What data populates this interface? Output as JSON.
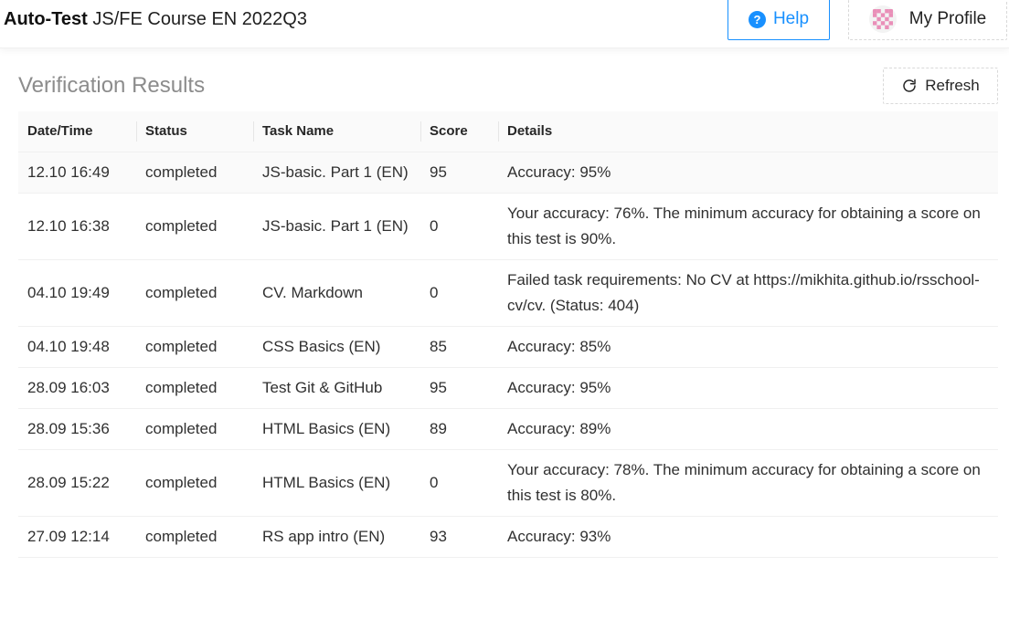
{
  "header": {
    "app_name": "Auto-Test",
    "course": "JS/FE Course EN 2022Q3",
    "help_label": "Help",
    "profile_label": "My Profile"
  },
  "page": {
    "title": "Verification Results",
    "refresh_label": "Refresh"
  },
  "table": {
    "columns": [
      "Date/Time",
      "Status",
      "Task Name",
      "Score",
      "Details"
    ],
    "rows": [
      {
        "datetime": "12.10 16:49",
        "status": "completed",
        "task": "JS-basic. Part 1 (EN)",
        "score": "95",
        "details": "Accuracy: 95%"
      },
      {
        "datetime": "12.10 16:38",
        "status": "completed",
        "task": "JS-basic. Part 1 (EN)",
        "score": "0",
        "details": "Your accuracy: 76%. The minimum accuracy for obtaining a score on this test is 90%."
      },
      {
        "datetime": "04.10 19:49",
        "status": "completed",
        "task": "CV. Markdown",
        "score": "0",
        "details": "Failed task requirements: No CV at https://mikhita.github.io/rsschool-cv/cv. (Status: 404)"
      },
      {
        "datetime": "04.10 19:48",
        "status": "completed",
        "task": "CSS Basics (EN)",
        "score": "85",
        "details": "Accuracy: 85%"
      },
      {
        "datetime": "28.09 16:03",
        "status": "completed",
        "task": "Test Git & GitHub",
        "score": "95",
        "details": "Accuracy: 95%"
      },
      {
        "datetime": "28.09 15:36",
        "status": "completed",
        "task": "HTML Basics (EN)",
        "score": "89",
        "details": "Accuracy: 89%"
      },
      {
        "datetime": "28.09 15:22",
        "status": "completed",
        "task": "HTML Basics (EN)",
        "score": "0",
        "details": "Your accuracy: 78%. The minimum accuracy for obtaining a score on this test is 80%."
      },
      {
        "datetime": "27.09 12:14",
        "status": "completed",
        "task": "RS app intro (EN)",
        "score": "93",
        "details": "Accuracy: 93%"
      }
    ]
  },
  "icons": {
    "help": "question-circle-icon",
    "avatar": "identicon-avatar",
    "refresh": "reload-icon"
  },
  "colors": {
    "accent": "#1890ff",
    "title_gray": "#8c8c8c",
    "header_bg": "#fafafa"
  }
}
